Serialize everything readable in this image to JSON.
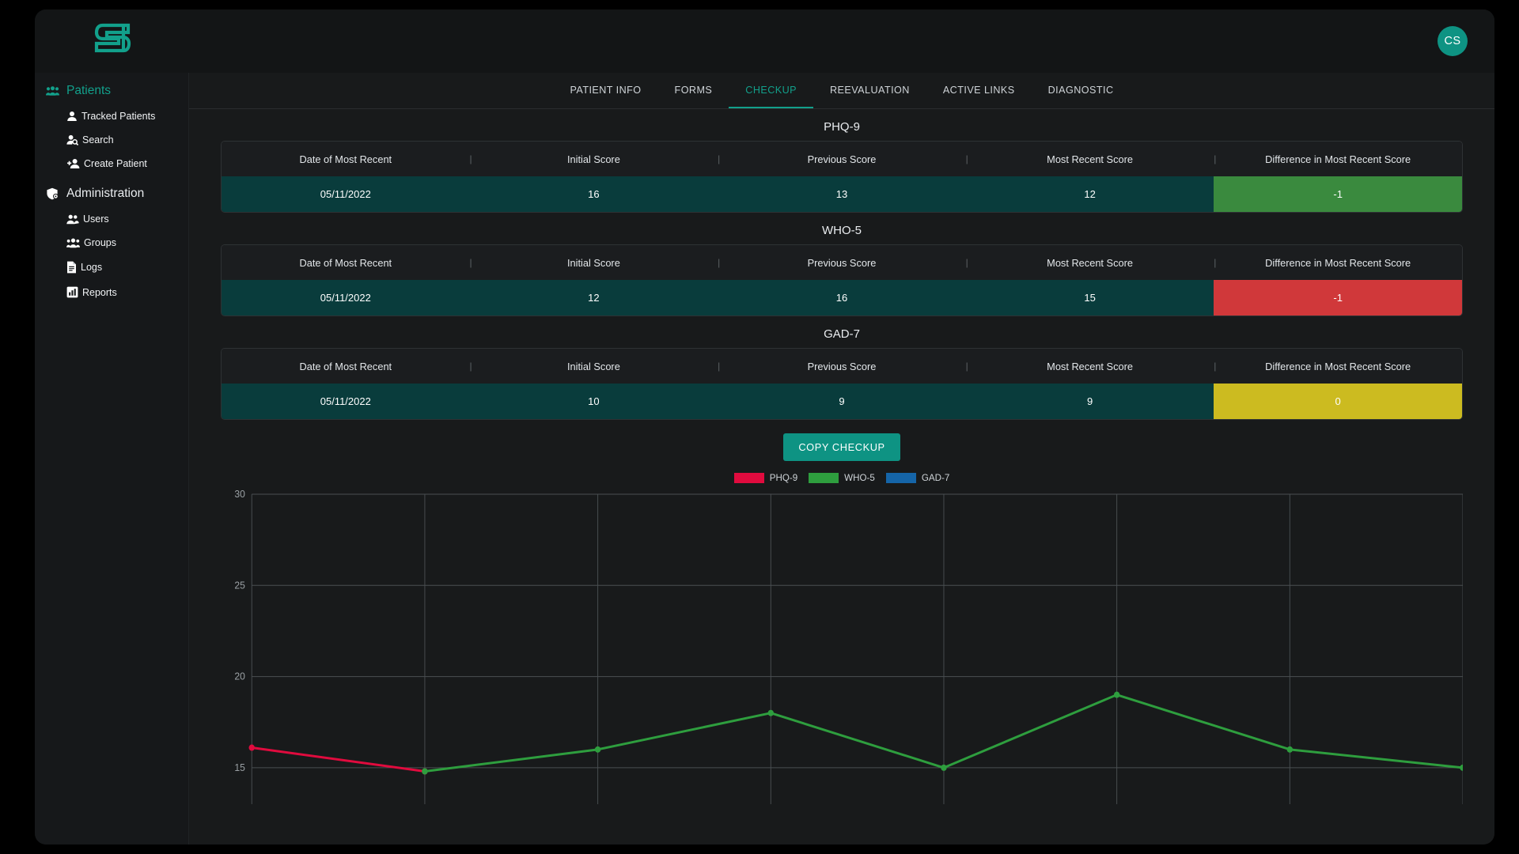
{
  "app": {
    "logo_icon": "s-logo-icon",
    "avatar_initials": "CS"
  },
  "sidebar": {
    "groups": [
      {
        "label": "Patients",
        "icon": "people-group-icon",
        "items": [
          {
            "label": "Tracked Patients",
            "icon": "person-icon"
          },
          {
            "label": "Search",
            "icon": "person-search-icon"
          },
          {
            "label": "Create Patient",
            "icon": "person-add-icon"
          }
        ]
      },
      {
        "label": "Administration",
        "icon": "shield-gear-icon",
        "items": [
          {
            "label": "Users",
            "icon": "users-icon"
          },
          {
            "label": "Groups",
            "icon": "groups-icon"
          },
          {
            "label": "Logs",
            "icon": "document-lines-icon"
          },
          {
            "label": "Reports",
            "icon": "bar-chart-icon"
          }
        ]
      }
    ]
  },
  "tabs": [
    {
      "label": "PATIENT INFO",
      "active": false
    },
    {
      "label": "FORMS",
      "active": false
    },
    {
      "label": "CHECKUP",
      "active": true
    },
    {
      "label": "REEVALUATION",
      "active": false
    },
    {
      "label": "ACTIVE LINKS",
      "active": false
    },
    {
      "label": "DIAGNOSTIC",
      "active": false
    }
  ],
  "columns": [
    "Date of Most Recent",
    "Initial Score",
    "Previous Score",
    "Most Recent Score",
    "Difference in Most Recent Score"
  ],
  "tables": [
    {
      "title": "PHQ-9",
      "date": "05/11/2022",
      "initial": "16",
      "previous": "13",
      "recent": "12",
      "difference": "-1",
      "difference_color": "#3a8a3e"
    },
    {
      "title": "WHO-5",
      "date": "05/11/2022",
      "initial": "12",
      "previous": "16",
      "recent": "15",
      "difference": "-1",
      "difference_color": "#d0383a"
    },
    {
      "title": "GAD-7",
      "date": "05/11/2022",
      "initial": "10",
      "previous": "9",
      "recent": "9",
      "difference": "0",
      "difference_color": "#ccbb20"
    }
  ],
  "copy_button": {
    "label": "COPY CHECKUP"
  },
  "chart_data": {
    "type": "line",
    "title": "",
    "xlabel": "",
    "ylabel": "",
    "ylim": [
      13,
      30
    ],
    "yticks": [
      15,
      20,
      25,
      30
    ],
    "grid": true,
    "legend_position": "top",
    "x": [
      0,
      1,
      2,
      3,
      4,
      5,
      6,
      7
    ],
    "series": [
      {
        "name": "PHQ-9",
        "color": "#e00b3e",
        "values": [
          16.1,
          14.8,
          null,
          null,
          null,
          null,
          null,
          null
        ]
      },
      {
        "name": "WHO-5",
        "color": "#2e9e3e",
        "values": [
          null,
          14.8,
          16.0,
          18.0,
          15.0,
          19.0,
          16.0,
          15.0
        ]
      },
      {
        "name": "GAD-7",
        "color": "#1565a8",
        "values": [
          null,
          null,
          null,
          null,
          null,
          null,
          null,
          null
        ]
      }
    ]
  }
}
